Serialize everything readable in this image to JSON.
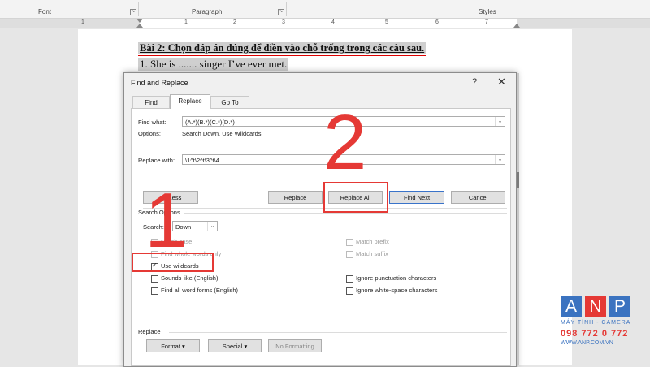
{
  "ribbon": {
    "font": "Font",
    "paragraph": "Paragraph",
    "styles": "Styles"
  },
  "ruler": {
    "numbers": [
      "1",
      "1",
      "2",
      "3",
      "4",
      "5",
      "6",
      "7"
    ]
  },
  "document": {
    "title": "Bài 2: Chọn đáp án đúng để điền vào chỗ trống trong các câu sau.",
    "line1": "1. She is ....... singer I’ve ever met."
  },
  "dialog": {
    "title": "Find and Replace",
    "help": "?",
    "close": "✕",
    "tabs": [
      "Find",
      "Replace",
      "Go To"
    ],
    "find_label": "Find what:",
    "find_value": "(A.*)(B.*)(C.*)(D.*)",
    "options_label": "Options:",
    "options_value": "Search Down, Use Wildcards",
    "replace_label": "Replace with:",
    "replace_value": "\\1^t\\2^t\\3^t\\4",
    "buttons": {
      "less": "<< Less",
      "replace": "Replace",
      "replace_all": "Replace All",
      "find_next": "Find Next",
      "cancel": "Cancel"
    },
    "search_options": "Search Options",
    "search_label": "Search:",
    "search_value": "Down",
    "checks_left": [
      {
        "label": "Match case",
        "checked": false,
        "enabled": false
      },
      {
        "label": "Find whole words only",
        "checked": false,
        "enabled": false
      },
      {
        "label": "Use wildcards",
        "checked": true,
        "enabled": true
      },
      {
        "label": "Sounds like (English)",
        "checked": false,
        "enabled": true
      },
      {
        "label": "Find all word forms (English)",
        "checked": false,
        "enabled": true
      }
    ],
    "checks_right": [
      {
        "label": "Match prefix",
        "checked": false,
        "enabled": false
      },
      {
        "label": "Match suffix",
        "checked": false,
        "enabled": false
      },
      {
        "label": "Ignore punctuation characters",
        "checked": false,
        "enabled": true
      },
      {
        "label": "Ignore white-space characters",
        "checked": false,
        "enabled": true
      }
    ],
    "replace_section": "Replace",
    "format_btn": "Format ▾",
    "special_btn": "Special ▾",
    "no_formatting_btn": "No Formatting"
  },
  "annotations": {
    "step1": "1",
    "step2": "2"
  },
  "colors": {
    "annotation": "#e53935",
    "brand_blue": "#3b73c0"
  },
  "logo": {
    "letters": [
      "A",
      "N",
      "P"
    ],
    "line1": "MÁY TÍNH - CAMERA",
    "phone": "098 772 0 772",
    "website": "WWW.ANP.COM.VN"
  }
}
